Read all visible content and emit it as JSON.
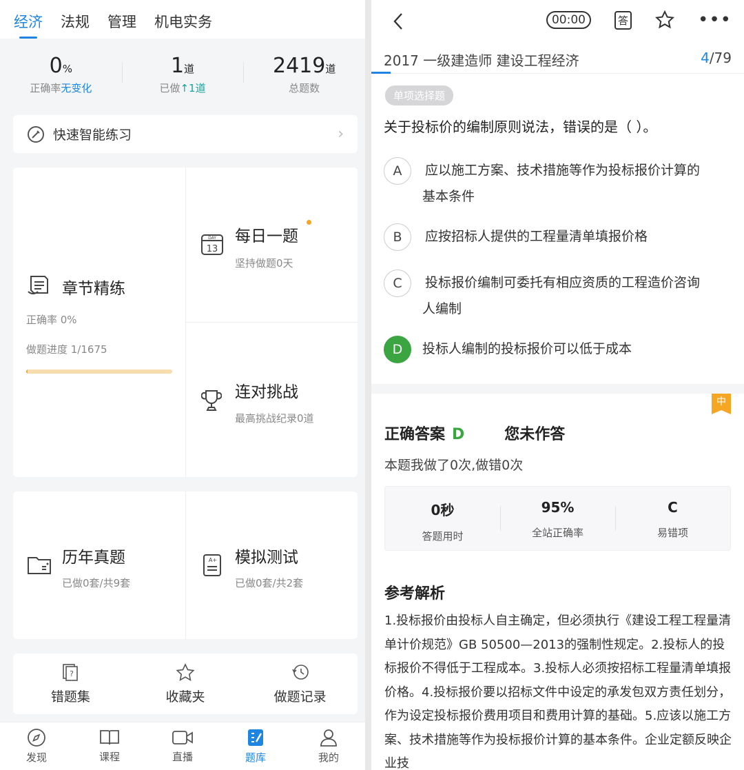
{
  "left": {
    "tabs": [
      "经济",
      "法规",
      "管理",
      "机电实务"
    ],
    "stats": [
      {
        "value": "0",
        "unit": "%",
        "label_prefix": "正确率",
        "label_highlight": "无变化"
      },
      {
        "value": "1",
        "unit": "道",
        "label_prefix": "已做",
        "label_highlight": "↑1道"
      },
      {
        "value": "2419",
        "unit": "道",
        "label_prefix": "总题数",
        "label_highlight": ""
      }
    ],
    "quick_practice": "快速智能练习",
    "chapter": {
      "title": "章节精练",
      "accuracy": "正确率 0%",
      "progress_text": "做题进度 1/1675",
      "progress_fraction": 0.0006
    },
    "daily": {
      "title": "每日一题",
      "sub": "坚持做题0天",
      "icon_day": "DAY",
      "icon_num": "13"
    },
    "challenge": {
      "title": "连对挑战",
      "sub": "最高挑战纪录0道"
    },
    "past": {
      "title": "历年真题",
      "sub": "已做0套/共9套"
    },
    "mock": {
      "title": "模拟测试",
      "sub": "已做0套/共2套"
    },
    "tools": [
      "错题集",
      "收藏夹",
      "做题记录"
    ],
    "nav": [
      "发现",
      "课程",
      "直播",
      "题库",
      "我的"
    ]
  },
  "right": {
    "timer": "00:00",
    "answer_icon": "答",
    "subject": "2017 一级建造师 建设工程经济",
    "progress_current": "4",
    "progress_total": "/79",
    "question_type": "单项选择题",
    "question": "关于投标价的编制原则说法，错误的是（ ）。",
    "options": [
      {
        "key": "A",
        "text": "应以施工方案、技术措施等作为投标报价计算的",
        "text2": "基本条件"
      },
      {
        "key": "B",
        "text": "应按招标人提供的工程量清单填报价格",
        "text2": ""
      },
      {
        "key": "C",
        "text": "投标报价编制可委托有相应资质的工程造价咨询",
        "text2": "人编制"
      },
      {
        "key": "D",
        "text": "投标人编制的投标报价可以低于成本",
        "text2": ""
      }
    ],
    "difficulty": "中",
    "correct_label": "正确答案",
    "correct_answer": "D",
    "your_answer": "您未作答",
    "times": "本题我做了0次,做错0次",
    "stats": [
      {
        "value": "0秒",
        "label": "答题用时"
      },
      {
        "value": "95%",
        "label": "全站正确率"
      },
      {
        "value": "C",
        "label": "易错项"
      }
    ],
    "analysis_title": "参考解析",
    "analysis": "1.投标报价由投标人自主确定，但必须执行《建设工程工程量清单计价规范》GB 50500—2013的强制性规定。2.投标人的投标报价不得低于工程成本。3.投标人必须按招标工程量清单填报价格。4.投标报价要以招标文件中设定的承发包双方责任划分，作为设定投标报价费用项目和费用计算的基础。5.应该以施工方案、技术措施等作为投标报价计算的基本条件。企业定额反映企业技"
  },
  "colors": {
    "accent": "#1e86e0",
    "correct": "#3aa541",
    "teal": "#17a3a0",
    "flag": "#f5a623",
    "progress": "#f7dcae"
  }
}
